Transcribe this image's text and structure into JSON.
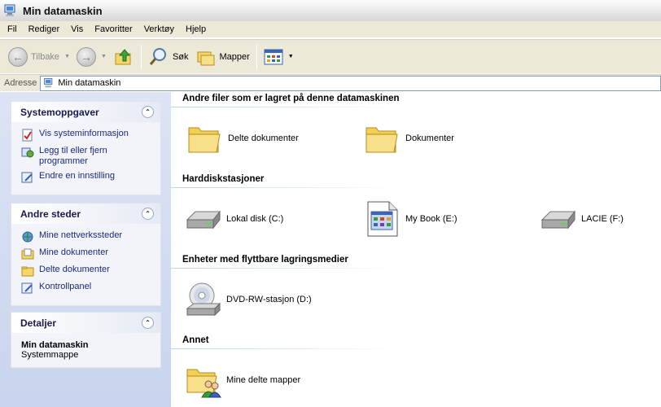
{
  "window": {
    "title": "Min datamaskin"
  },
  "menu": [
    "Fil",
    "Rediger",
    "Vis",
    "Favoritter",
    "Verktøy",
    "Hjelp"
  ],
  "toolbar": {
    "back_label": "Tilbake",
    "search_label": "Søk",
    "folders_label": "Mapper"
  },
  "address": {
    "label": "Adresse",
    "value": "Min datamaskin"
  },
  "panels": {
    "system": {
      "title": "Systemoppgaver",
      "items": [
        "Vis systeminformasjon",
        "Legg til eller fjern programmer",
        "Endre en innstilling"
      ]
    },
    "places": {
      "title": "Andre steder",
      "items": [
        "Mine nettverkssteder",
        "Mine dokumenter",
        "Delte dokumenter",
        "Kontrollpanel"
      ]
    },
    "details": {
      "title": "Detaljer",
      "name": "Min datamaskin",
      "type": "Systemmappe"
    }
  },
  "groups": {
    "files": {
      "title": "Andre filer som er lagret på denne datamaskinen",
      "items": [
        "Delte dokumenter",
        "Dokumenter"
      ]
    },
    "drives": {
      "title": "Harddiskstasjoner",
      "items": [
        "Lokal disk (C:)",
        "My Book (E:)",
        "LACIE (F:)"
      ]
    },
    "removable": {
      "title": "Enheter med flyttbare lagringsmedier",
      "items": [
        "DVD-RW-stasjon (D:)"
      ]
    },
    "other": {
      "title": "Annet",
      "items": [
        "Mine delte mapper"
      ]
    }
  }
}
